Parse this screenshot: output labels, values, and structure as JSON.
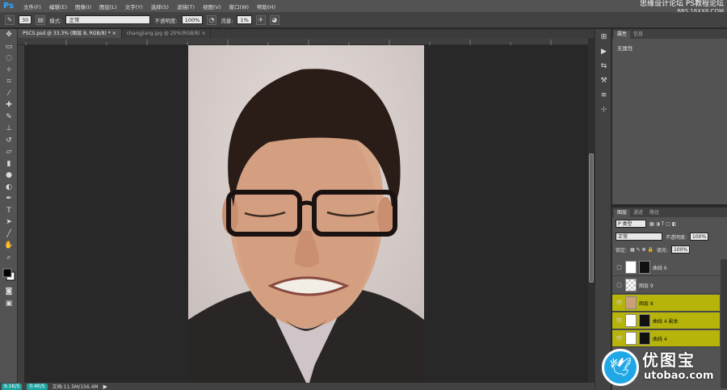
{
  "menubar": {
    "logo": "Ps",
    "items": [
      "文件(F)",
      "编辑(E)",
      "图像(I)",
      "图层(L)",
      "文字(Y)",
      "选择(S)",
      "滤镜(T)",
      "视图(V)",
      "窗口(W)",
      "帮助(H)"
    ]
  },
  "watermark": {
    "line1": "思缘设计论坛  PS教程论坛",
    "line2": "BBS.16XX8.COM"
  },
  "options": {
    "brush_size": "30",
    "mode_label": "模式:",
    "mode_value": "正常",
    "opacity_label": "不透明度:",
    "opacity_value": "100%",
    "flow_label": "流量:",
    "flow_value": "1%"
  },
  "tabs": [
    {
      "label": "PSCS.psd @ 33.3% (图层 8, RGB/8) *",
      "close": "×"
    },
    {
      "label": "changjiang.jpg @ 25%(RGB/8)",
      "close": "×"
    }
  ],
  "status": {
    "pill1": "6.1K/S",
    "pill2": "0.4K/S",
    "doc": "文档:11.5M/156.4M"
  },
  "properties": {
    "tabs": [
      "属性",
      "信息"
    ],
    "body": "无属性"
  },
  "layers_panel": {
    "tabs": [
      "图层",
      "通道",
      "路径"
    ],
    "filter": "P 类型",
    "blend": "正常",
    "opacity_label": "不透明度:",
    "opacity": "100%",
    "lock_label": "锁定:",
    "fill_label": "填充:",
    "fill": "100%",
    "rows": [
      {
        "name": "曲线 6",
        "selected": false
      },
      {
        "name": "图层 9",
        "selected": false
      },
      {
        "name": "图层 8",
        "selected": true
      },
      {
        "name": "曲线 4 副本",
        "selected": true
      },
      {
        "name": "曲线 4",
        "selected": true
      }
    ]
  },
  "brand": {
    "cn": "优图宝",
    "en": "utobao.com"
  },
  "colors": {
    "accent": "#31a8ff",
    "selection": "#b6b40a",
    "brand": "#20a8e6"
  }
}
